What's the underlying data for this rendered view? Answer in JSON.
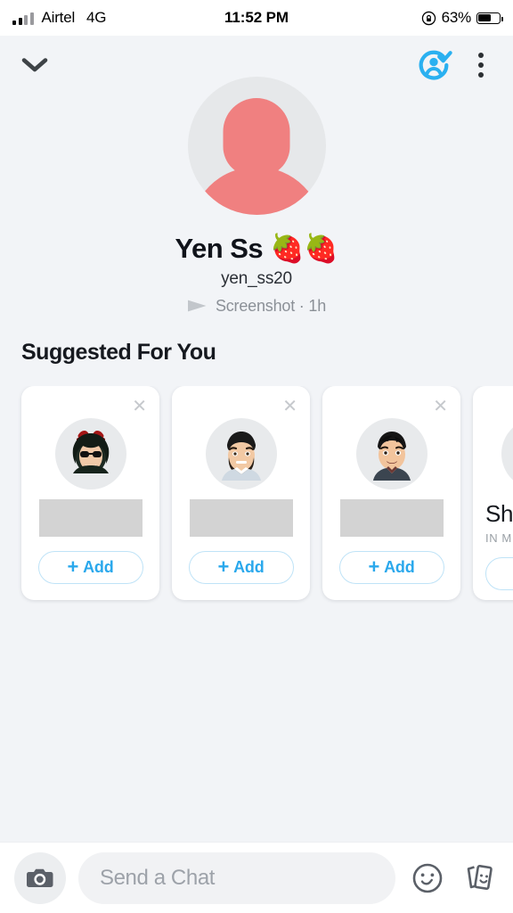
{
  "status_bar": {
    "carrier": "Airtel",
    "network": "4G",
    "time": "11:52 PM",
    "battery_percent": "63%",
    "battery_level": 63,
    "rotation_lock_icon": "rotation-lock-icon",
    "signal_icon": "signal-bars-icon"
  },
  "header": {
    "back_icon": "chevron-down-icon",
    "friend_status_icon": "friend-added-check-icon",
    "more_icon": "kebab-menu-icon",
    "accent_color": "#2AB0F0"
  },
  "profile": {
    "avatar_icon": "default-avatar-icon",
    "display_name": "Yen Ss 🍓🍓",
    "username": "yen_ss20",
    "status_icon": "sent-arrow-icon",
    "status_text": "Screenshot · 1h"
  },
  "suggested": {
    "title": "Suggested For You",
    "close_icon": "close-icon",
    "add_label": "Add",
    "add_plus": "+",
    "cards": [
      {
        "avatar_icon": "bitmoji-devil-sunglasses-icon",
        "name_redacted": true,
        "name": "",
        "subtitle": "",
        "add_label": "Add"
      },
      {
        "avatar_icon": "bitmoji-bearded-man-icon",
        "name_redacted": true,
        "name": "",
        "subtitle": "",
        "add_label": "Add"
      },
      {
        "avatar_icon": "bitmoji-young-man-icon",
        "name_redacted": true,
        "name": "",
        "subtitle": "",
        "add_label": "Add"
      },
      {
        "avatar_icon": "bitmoji-partial-icon",
        "name_redacted": false,
        "name": "Sha",
        "subtitle": "IN M",
        "add_label": ""
      }
    ]
  },
  "bottom_bar": {
    "camera_icon": "camera-icon",
    "chat_placeholder": "Send a Chat",
    "chat_value": "",
    "emoji_icon": "smiley-face-icon",
    "sticker_icon": "sticker-cards-icon"
  }
}
